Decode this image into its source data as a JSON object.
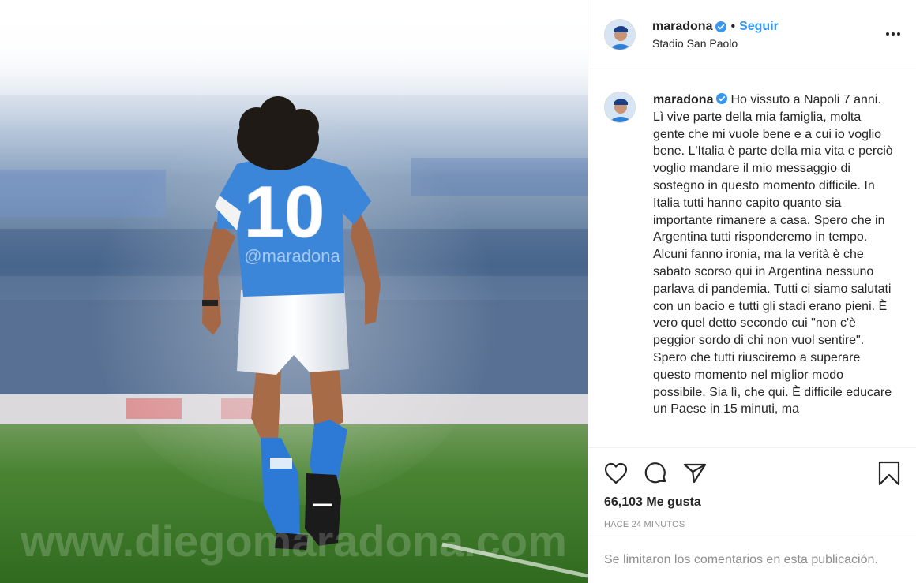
{
  "post": {
    "username": "maradona",
    "verified": true,
    "separator": "•",
    "follow_label": "Seguir",
    "location": "Stadio San Paolo",
    "more_icon": "three-dots-icon"
  },
  "photo": {
    "jersey_number": "10",
    "watermark_handle": "@maradona",
    "watermark_url": "www.diegomaradona.com",
    "colors": {
      "jersey": "#2f7fd6",
      "grass": "#3f7a2a",
      "sky": "#f4f7fb"
    }
  },
  "caption": {
    "username": "maradona",
    "text": "Ho vissuto a Napoli 7 anni. Lì vive parte della mia famiglia, molta gente che mi vuole bene e a cui io voglio bene. L'Italia è parte della mia vita e perciò voglio mandare il mio messaggio di sostegno in questo momento difficile. In Italia tutti hanno capito quanto sia importante rimanere a casa. Spero che in Argentina tutti risponderemo in tempo. Alcuni fanno ironia, ma la verità è che sabato scorso qui in Argentina nessuno parlava di pandemia. Tutti ci siamo salutati con un bacio e tutti gli stadi erano pieni. È vero quel detto secondo cui \"non c'è peggior sordo di chi non vuol sentire\". Spero che tutti riusciremo a superare questo momento nel miglior modo possibile. Sia lì, che qui. È difficile educare un Paese in 15 minuti, ma"
  },
  "actions": {
    "like_icon": "heart-icon",
    "comment_icon": "comment-icon",
    "share_icon": "paper-plane-icon",
    "save_icon": "bookmark-icon"
  },
  "stats": {
    "likes_count": "66,103",
    "likes_label": "Me gusta",
    "time_ago": "HACE 24 MINUTOS"
  },
  "footer": {
    "comments_disabled": "Se limitaron los comentarios en esta publicación."
  }
}
